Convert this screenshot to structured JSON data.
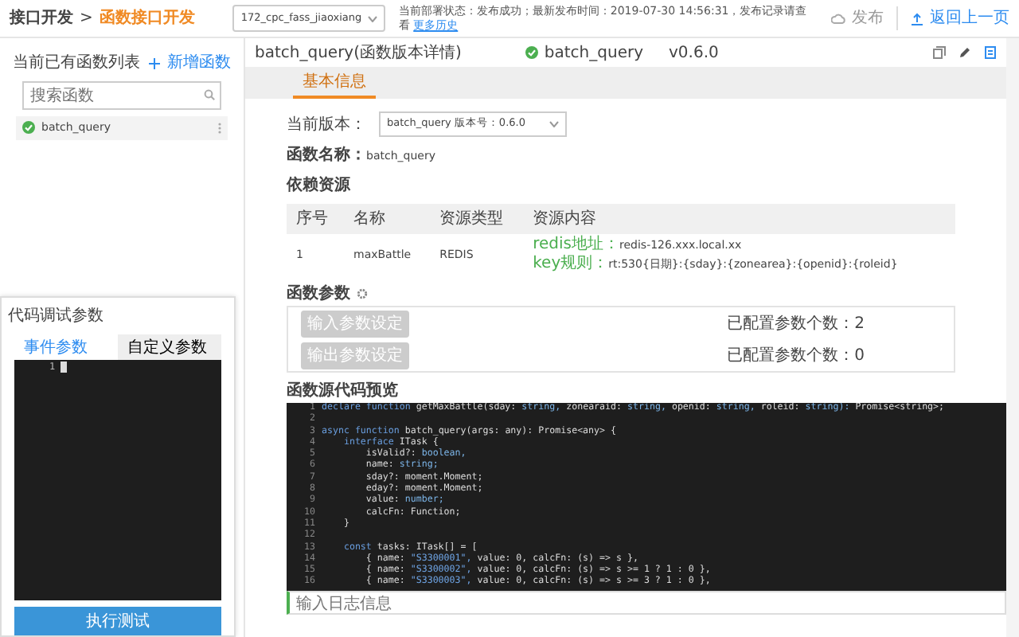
{
  "breadcrumb": [
    {
      "label": "接口开发",
      "selected": false
    },
    {
      "label": "函数接口开发",
      "selected": true
    }
  ],
  "breadcrumb_separator": ">",
  "env_select": {
    "value": "172_cpc_fass_jiaoxiang"
  },
  "deploy_status": {
    "text": "当前部署状态：发布成功；最新发布时间：2019-07-30 14:56:31，发布记录请查看",
    "link": "更多历史"
  },
  "publish_button": "发布",
  "back_link": "返回上一页",
  "sidebar": {
    "title": "当前已有函数列表",
    "add_button": "新增函数",
    "search": {
      "placeholder": "搜索函数"
    },
    "items": [
      {
        "name": "batch_query",
        "kind": "success",
        "selected": true
      }
    ]
  },
  "detail": {
    "title": "batch_query(函数版本详情)",
    "function_badge": "batch_query",
    "version": "v0.6.0",
    "tabs": [
      {
        "label": "基本信息",
        "selected": true
      }
    ],
    "version_label": "当前版本：",
    "version_select": "batch_query  版本号：0.6.0",
    "name_label": "函数名称：",
    "name_value": "batch_query",
    "resources_title": "依赖资源",
    "table": {
      "columns": [
        "序号",
        "名称",
        "资源类型",
        "资源内容"
      ],
      "rows": [
        {
          "cells": [
            "1",
            "maxBattle",
            "REDIS"
          ],
          "content": [
            {
              "key": "redis地址：",
              "value": "redis-126.xxx.local.xx"
            },
            {
              "key": "key规则：",
              "value": "rt:530{日期}:{sday}:{zonearea}:{openid}:{roleid}"
            }
          ]
        }
      ]
    },
    "params": {
      "title": "函数参数",
      "rows": [
        {
          "button": "输入参数设定",
          "disabled": true,
          "count": "已配置参数个数：2"
        },
        {
          "button": "输出参数设定",
          "disabled": true,
          "count": "已配置参数个数：0"
        }
      ]
    },
    "code_title": "函数源代码预览",
    "code": [
      {
        "number": "1",
        "tokens": [
          {
            "text": "declare function",
            "kind": "keyword"
          },
          {
            "text": "getMaxBattle(sday:",
            "kind": "plain"
          },
          {
            "text": "string,",
            "kind": "type"
          },
          {
            "text": "zonearaid:",
            "kind": "plain"
          },
          {
            "text": "string,",
            "kind": "type"
          },
          {
            "text": "openid:",
            "kind": "plain"
          },
          {
            "text": "string,",
            "kind": "type"
          },
          {
            "text": "roleid:",
            "kind": "plain"
          },
          {
            "text": "string):",
            "kind": "type"
          },
          {
            "text": "Promise<string>;",
            "kind": "plain"
          }
        ]
      },
      {
        "number": "2"
      },
      {
        "number": "3",
        "tokens": [
          {
            "text": "async function",
            "kind": "keyword"
          },
          {
            "text": "batch_query(args: any): Promise<any> {",
            "kind": "plain"
          }
        ]
      },
      {
        "number": "4",
        "tokens": [
          {
            "text": "    interface",
            "kind": "keyword"
          },
          {
            "text": "ITask {",
            "kind": "plain"
          }
        ]
      },
      {
        "number": "5",
        "tokens": [
          {
            "text": "        isValid?:",
            "kind": "plain"
          },
          {
            "text": "boolean,",
            "kind": "type"
          }
        ]
      },
      {
        "number": "6",
        "tokens": [
          {
            "text": "        name:",
            "kind": "plain"
          },
          {
            "text": "string;",
            "kind": "type"
          }
        ]
      },
      {
        "number": "7",
        "tokens": [
          {
            "text": "        sday?: moment.Moment;",
            "kind": "plain"
          }
        ]
      },
      {
        "number": "8",
        "tokens": [
          {
            "text": "        eday?: moment.Moment;",
            "kind": "plain"
          }
        ]
      },
      {
        "number": "9",
        "tokens": [
          {
            "text": "        value:",
            "kind": "plain"
          },
          {
            "text": "number;",
            "kind": "type"
          }
        ]
      },
      {
        "number": "10",
        "tokens": [
          {
            "text": "        calcFn: Function;",
            "kind": "plain"
          }
        ]
      },
      {
        "number": "11",
        "tokens": [
          {
            "text": "    }",
            "kind": "plain"
          }
        ]
      },
      {
        "number": "12"
      },
      {
        "number": "13",
        "tokens": [
          {
            "text": "    const",
            "kind": "keyword"
          },
          {
            "text": "tasks: ITask[] = [",
            "kind": "plain"
          }
        ]
      },
      {
        "number": "14",
        "tokens": [
          {
            "text": "        { name:",
            "kind": "plain"
          },
          {
            "text": "\"S3300001\",",
            "kind": "string"
          },
          {
            "text": "value: 0, calcFn: (s) => s },",
            "kind": "plain"
          }
        ]
      },
      {
        "number": "15",
        "tokens": [
          {
            "text": "        { name:",
            "kind": "plain"
          },
          {
            "text": "\"S3300002\",",
            "kind": "string"
          },
          {
            "text": "value: 0, calcFn: (s) => s >= 1 ? 1 : 0 },",
            "kind": "plain"
          }
        ]
      },
      {
        "number": "16",
        "tokens": [
          {
            "text": "        { name:",
            "kind": "plain"
          },
          {
            "text": "\"S3300003\",",
            "kind": "string"
          },
          {
            "text": "value: 0, calcFn: (s) => s >= 3 ? 1 : 0 },",
            "kind": "plain"
          }
        ]
      }
    ],
    "log": {
      "placeholder": "输入日志信息"
    }
  },
  "debug": {
    "title": "代码调试参数",
    "tabs": [
      {
        "label": "事件参数",
        "selected": true
      },
      {
        "label": "自定义参数",
        "selected": false
      }
    ],
    "editor_lines": [
      {
        "number": "1"
      }
    ],
    "run_button": "执行测试"
  }
}
